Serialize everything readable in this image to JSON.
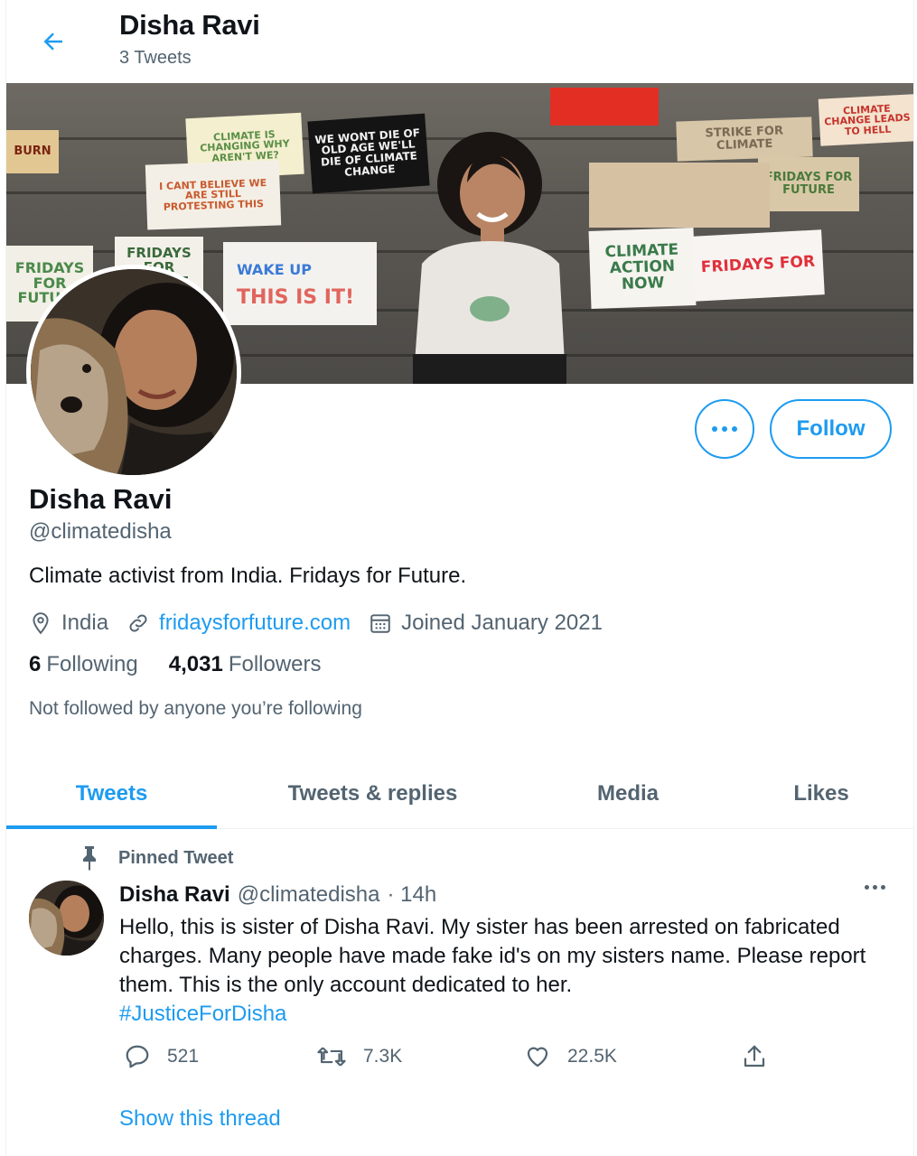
{
  "header": {
    "title": "Disha Ravi",
    "tweet_count": "3 Tweets"
  },
  "banner": {
    "signs": [
      "BURN",
      "CLIMATE IS CHANGING WHY AREN'T WE?",
      "WE WONT DIE OF OLD AGE WE'LL DIE OF CLIMATE CHANGE",
      "I CANT BELIEVE WE ARE STILL PROTESTING THIS",
      "STRIKE FOR CLIMATE",
      "CLIMATE CHANGE LEADS TO HELL",
      "FRIDAYS FOR FUTURE",
      "FRIDAYS FOR FUTURE",
      "FRIDAYS FOR FUTURE",
      "CLIMATE ACTION NOW",
      "FRIDAYS FOR"
    ]
  },
  "profile": {
    "name": "Disha Ravi",
    "handle": "@climatedisha",
    "bio": "Climate activist from India. Fridays for Future.",
    "location": "India",
    "website": "fridaysforfuture.com",
    "joined": "Joined January 2021",
    "following_count": "6",
    "following_label": "Following",
    "followers_count": "4,031",
    "followers_label": "Followers",
    "not_followed": "Not followed by anyone you’re following",
    "follow_button": "Follow"
  },
  "tabs": [
    {
      "label": "Tweets",
      "active": true
    },
    {
      "label": "Tweets & replies",
      "active": false
    },
    {
      "label": "Media",
      "active": false
    },
    {
      "label": "Likes",
      "active": false
    }
  ],
  "tweet": {
    "pinned_label": "Pinned Tweet",
    "author_name": "Disha Ravi",
    "author_handle": "@climatedisha",
    "time": "· 14h",
    "text": "Hello, this is sister of Disha Ravi. My sister has been arrested on fabricated charges. Many people have made fake id's on my sisters name. Please report them. This is the only account dedicated to her.",
    "hashtag": "#JusticeForDisha",
    "replies": "521",
    "retweets": "7.3K",
    "likes": "22.5K",
    "show_thread": "Show this thread"
  },
  "colors": {
    "accent": "#1d9bf0",
    "secondary_text": "#536471",
    "primary_text": "#0f1419"
  },
  "icons": [
    "back-arrow-icon",
    "more-icon",
    "location-icon",
    "link-icon",
    "calendar-icon",
    "pin-icon",
    "reply-icon",
    "retweet-icon",
    "like-icon",
    "share-icon"
  ]
}
